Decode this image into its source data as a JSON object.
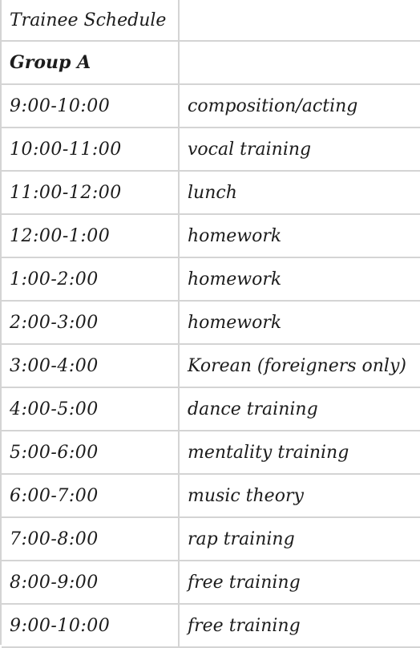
{
  "title": "Trainee Schedule",
  "group": "Group A",
  "schedule": [
    {
      "time": "9:00-10:00",
      "activity": "composition/acting"
    },
    {
      "time": "10:00-11:00",
      "activity": "vocal training"
    },
    {
      "time": "11:00-12:00",
      "activity": "lunch"
    },
    {
      "time": "12:00-1:00",
      "activity": "homework"
    },
    {
      "time": "1:00-2:00",
      "activity": "homework"
    },
    {
      "time": "2:00-3:00",
      "activity": "homework"
    },
    {
      "time": "3:00-4:00",
      "activity": "Korean (foreigners only)"
    },
    {
      "time": "4:00-5:00",
      "activity": "dance training"
    },
    {
      "time": "5:00-6:00",
      "activity": "mentality training"
    },
    {
      "time": "6:00-7:00",
      "activity": "music theory"
    },
    {
      "time": "7:00-8:00",
      "activity": "rap training"
    },
    {
      "time": "8:00-9:00",
      "activity": "free training"
    },
    {
      "time": "9:00-10:00",
      "activity": "free training"
    }
  ]
}
